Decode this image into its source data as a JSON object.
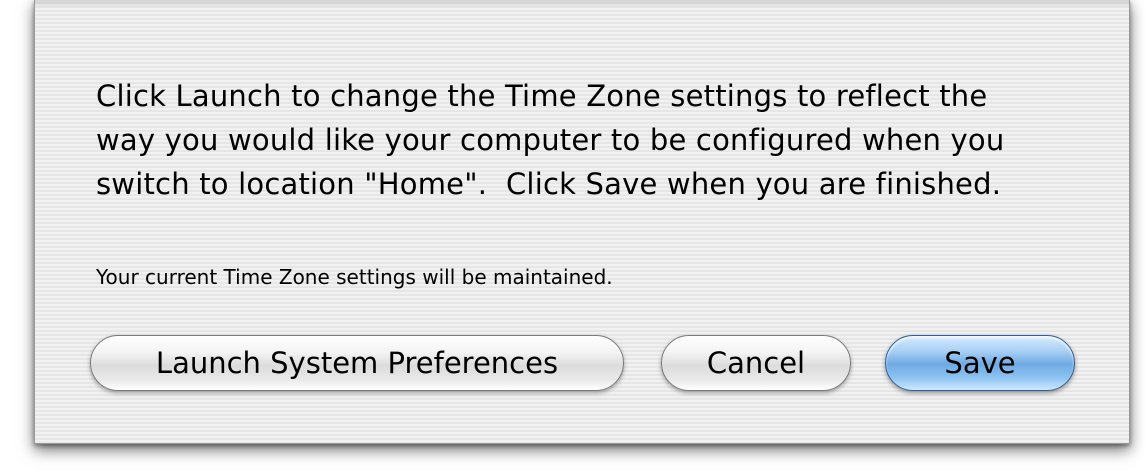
{
  "dialog": {
    "message_lines": [
      "Click Launch to change the Time Zone settings to reflect the",
      "way you would like your computer to be configured when you",
      "switch to location \"Home\".  Click Save when you are finished."
    ],
    "note": "Your current Time Zone settings will be maintained.",
    "buttons": {
      "launch_label": "Launch System Preferences",
      "cancel_label": "Cancel",
      "save_label": "Save"
    }
  },
  "colors": {
    "default_button": "#6ea9e3",
    "sheet_stripe_light": "#f1f1f1",
    "sheet_stripe_dark": "#e6e6e6"
  }
}
